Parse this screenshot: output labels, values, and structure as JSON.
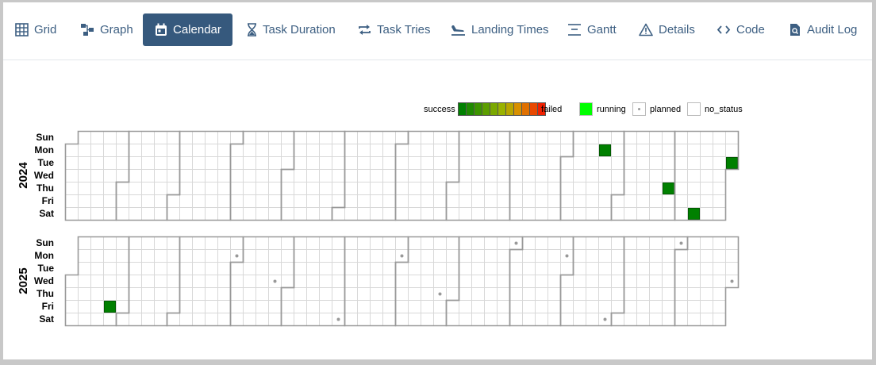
{
  "tabs": [
    {
      "label": "Grid",
      "icon": "grid-icon",
      "active": false
    },
    {
      "label": "Graph",
      "icon": "graph-icon",
      "active": false
    },
    {
      "label": "Calendar",
      "icon": "calendar-icon",
      "active": true
    },
    {
      "label": "Task Duration",
      "icon": "hourglass-icon",
      "active": false
    },
    {
      "label": "Task Tries",
      "icon": "repeat-icon",
      "active": false
    },
    {
      "label": "Landing Times",
      "icon": "landing-icon",
      "active": false
    },
    {
      "label": "Gantt",
      "icon": "gantt-icon",
      "active": false
    },
    {
      "label": "Details",
      "icon": "warning-icon",
      "active": false
    },
    {
      "label": "Code",
      "icon": "code-icon",
      "active": false
    },
    {
      "label": "Audit Log",
      "icon": "audit-log-icon",
      "active": false
    }
  ],
  "legend": {
    "success_label": "success",
    "failed_label": "failed",
    "running_label": "running",
    "planned_label": "planned",
    "no_status_label": "no_status",
    "gradient_colors": [
      "#008000",
      "#1f8a00",
      "#3d9400",
      "#5c9e00",
      "#7aa800",
      "#99b200",
      "#b8a600",
      "#d89000",
      "#e07000",
      "#e84800",
      "#f02000"
    ],
    "running_color": "#00ff00",
    "planned_color": "#ffffff",
    "no_status_color": "#ffffff"
  },
  "calendar": {
    "weekdays": [
      "Sun",
      "Mon",
      "Tue",
      "Wed",
      "Thu",
      "Fri",
      "Sat"
    ],
    "years": [
      {
        "year": "2024",
        "success_dates": [
          "2024-10-21",
          "2024-11-28",
          "2024-12-14",
          "2024-12-31"
        ],
        "planned_dates": []
      },
      {
        "year": "2025",
        "success_dates": [
          "2025-01-24"
        ],
        "planned_dates": [
          "2025-03-31",
          "2025-04-23",
          "2025-05-31",
          "2025-06-30",
          "2025-07-24",
          "2025-08-31",
          "2025-09-29",
          "2025-10-25",
          "2025-11-30",
          "2025-12-31"
        ]
      }
    ]
  },
  "colors": {
    "accent": "#36597d",
    "tab_text": "#3d5f82",
    "success": "#008000",
    "cell_border": "#d8d8d8",
    "month_border": "#999999"
  }
}
